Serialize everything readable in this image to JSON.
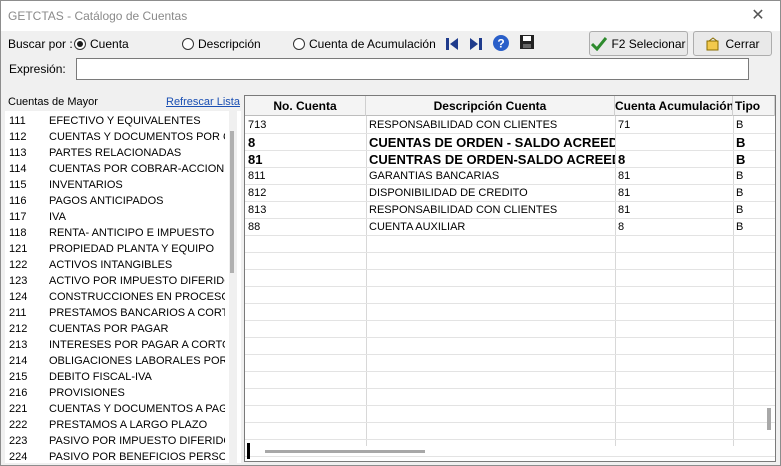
{
  "window": {
    "title": "GETCTAS - Catálogo de Cuentas"
  },
  "search": {
    "label": "Buscar por :",
    "options": [
      "Cuenta",
      "Descripción",
      "Cuenta de Acumulación"
    ],
    "selected": "Cuenta",
    "expression_label": "Expresión:",
    "expression_value": ""
  },
  "toolbar": {
    "icons": [
      "first-record-icon",
      "last-record-icon",
      "help-icon",
      "save-icon"
    ],
    "select_label": "F2 Selecionar",
    "close_label": "Cerrar"
  },
  "left_panel": {
    "title": "Cuentas de Mayor",
    "refresh_label": "Refrescar Lista",
    "items": [
      {
        "code": "111",
        "desc": "EFECTIVO Y EQUIVALENTES"
      },
      {
        "code": "112",
        "desc": "CUENTAS Y DOCUMENTOS POR CO"
      },
      {
        "code": "113",
        "desc": "PARTES RELACIONADAS"
      },
      {
        "code": "114",
        "desc": "CUENTAS POR COBRAR-ACCIONIST"
      },
      {
        "code": "115",
        "desc": "INVENTARIOS"
      },
      {
        "code": "116",
        "desc": "PAGOS ANTICIPADOS"
      },
      {
        "code": "117",
        "desc": "IVA"
      },
      {
        "code": "118",
        "desc": "RENTA- ANTICIPO E IMPUESTO"
      },
      {
        "code": "121",
        "desc": "PROPIEDAD PLANTA Y EQUIPO"
      },
      {
        "code": "122",
        "desc": "ACTIVOS INTANGIBLES"
      },
      {
        "code": "123",
        "desc": "ACTIVO POR IMPUESTO DIFERIDO"
      },
      {
        "code": "124",
        "desc": "CONSTRUCCIONES EN PROCESO"
      },
      {
        "code": "211",
        "desc": "PRESTAMOS BANCARIOS A CORTO"
      },
      {
        "code": "212",
        "desc": "CUENTAS POR PAGAR"
      },
      {
        "code": "213",
        "desc": "INTERESES POR PAGAR A CORTO P"
      },
      {
        "code": "214",
        "desc": "OBLIGACIONES LABORALES POR P"
      },
      {
        "code": "215",
        "desc": "DEBITO FISCAL-IVA"
      },
      {
        "code": "216",
        "desc": "PROVISIONES"
      },
      {
        "code": "221",
        "desc": "CUENTAS Y DOCUMENTOS A PAGA"
      },
      {
        "code": "222",
        "desc": "PRESTAMOS A LARGO PLAZO"
      },
      {
        "code": "223",
        "desc": "PASIVO POR IMPUESTO DIFERIDO"
      },
      {
        "code": "224",
        "desc": "PASIVO POR BENEFICIOS PERSONA"
      }
    ]
  },
  "grid": {
    "columns": [
      "No. Cuenta",
      "Descripción Cuenta",
      "Cuenta Acumulación",
      "Tipo"
    ],
    "rows": [
      {
        "cuenta": "713",
        "descripcion": "RESPONSABILIDAD CON CLIENTES",
        "acumulacion": "71",
        "tipo": "B",
        "big": false
      },
      {
        "cuenta": "8",
        "descripcion": "CUENTAS DE ORDEN - SALDO ACREED",
        "acumulacion": "",
        "tipo": "B",
        "big": true
      },
      {
        "cuenta": "81",
        "descripcion": "CUENTRAS DE ORDEN-SALDO ACREED",
        "acumulacion": "8",
        "tipo": "B",
        "big": true
      },
      {
        "cuenta": "811",
        "descripcion": "GARANTIAS BANCARIAS",
        "acumulacion": "81",
        "tipo": "B",
        "big": false
      },
      {
        "cuenta": "812",
        "descripcion": "DISPONIBILIDAD DE CREDITO",
        "acumulacion": "81",
        "tipo": "B",
        "big": false
      },
      {
        "cuenta": "813",
        "descripcion": "RESPONSABILIDAD CON CLIENTES",
        "acumulacion": "81",
        "tipo": "B",
        "big": false
      },
      {
        "cuenta": "88",
        "descripcion": "CUENTA AUXILIAR",
        "acumulacion": "8",
        "tipo": "B",
        "big": false
      }
    ]
  }
}
